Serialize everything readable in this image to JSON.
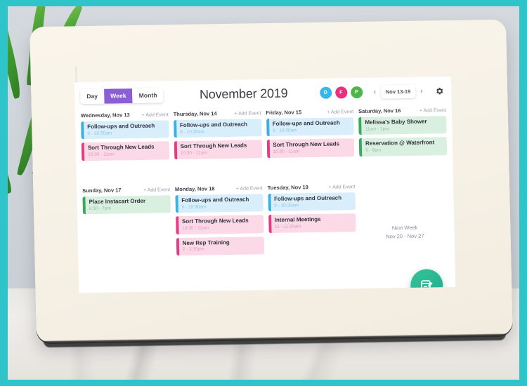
{
  "app": {
    "title": "November 2019"
  },
  "toolbar": {
    "views": [
      {
        "label": "Day",
        "active": false
      },
      {
        "label": "Week",
        "active": true
      },
      {
        "label": "Month",
        "active": false
      }
    ],
    "avatars": [
      {
        "initial": "D",
        "color": "#39b6e8"
      },
      {
        "initial": "F",
        "color": "#e8307c"
      },
      {
        "initial": "P",
        "color": "#4cb648"
      }
    ],
    "prev_label": "‹",
    "next_label": "›",
    "date_range": "Nov 13-19",
    "settings_icon": "gear-icon",
    "active_view_color": "#8b5ed6"
  },
  "colors": {
    "blue": "#3bb0e5",
    "pink": "#e63b84",
    "green": "#3aaa5e",
    "fab": "#22ab8c",
    "frame": "#2ec4c9"
  },
  "calendar": {
    "add_event_label": "+ Add Event",
    "days": [
      {
        "name": "Wednesday, Nov 13",
        "events": [
          {
            "title": "Follow-ups and Outreach",
            "time": "9 - 10:30am",
            "color": "blue"
          },
          {
            "title": "Sort Through New Leads",
            "time": "10:30 - 11am",
            "color": "pink"
          }
        ]
      },
      {
        "name": "Thursday, Nov 14",
        "events": [
          {
            "title": "Follow-ups and Outreach",
            "time": "9 - 10:30am",
            "color": "blue"
          },
          {
            "title": "Sort Through New Leads",
            "time": "10:30 - 11am",
            "color": "pink"
          }
        ]
      },
      {
        "name": "Friday, Nov 15",
        "events": [
          {
            "title": "Follow-ups and Outreach",
            "time": "9 - 10:30am",
            "color": "blue"
          },
          {
            "title": "Sort Through New Leads",
            "time": "10:30 - 11am",
            "color": "pink"
          }
        ]
      },
      {
        "name": "Saturday, Nov 16",
        "events": [
          {
            "title": "Melissa's Baby Shower",
            "time": "11am - 1pm",
            "color": "green"
          },
          {
            "title": "Reservation @ Waterfront",
            "time": "6 - 8pm",
            "color": "green"
          }
        ]
      },
      {
        "name": "Sunday, Nov 17",
        "events": [
          {
            "title": "Place Instacart Order",
            "time": "6:30 - 7pm",
            "color": "green"
          }
        ]
      },
      {
        "name": "Monday, Nov 18",
        "events": [
          {
            "title": "Follow-ups and Outreach",
            "time": "9 - 10:30am",
            "color": "blue"
          },
          {
            "title": "Sort Through New Leads",
            "time": "10:30 - 11am",
            "color": "pink"
          },
          {
            "title": "New Rep Training",
            "time": "2 - 2:30pm",
            "color": "pink"
          }
        ]
      },
      {
        "name": "Tuesday, Nov 19",
        "events": [
          {
            "title": "Follow-ups and Outreach",
            "time": "9 - 10:30am",
            "color": "blue"
          },
          {
            "title": "Internal Meetings",
            "time": "11 - 11:30am",
            "color": "pink"
          }
        ]
      }
    ],
    "next_week": {
      "title": "Next Week",
      "range": "Nov 20 - Nov 27"
    }
  },
  "fab": {
    "icon": "add-event-calendar-icon"
  }
}
